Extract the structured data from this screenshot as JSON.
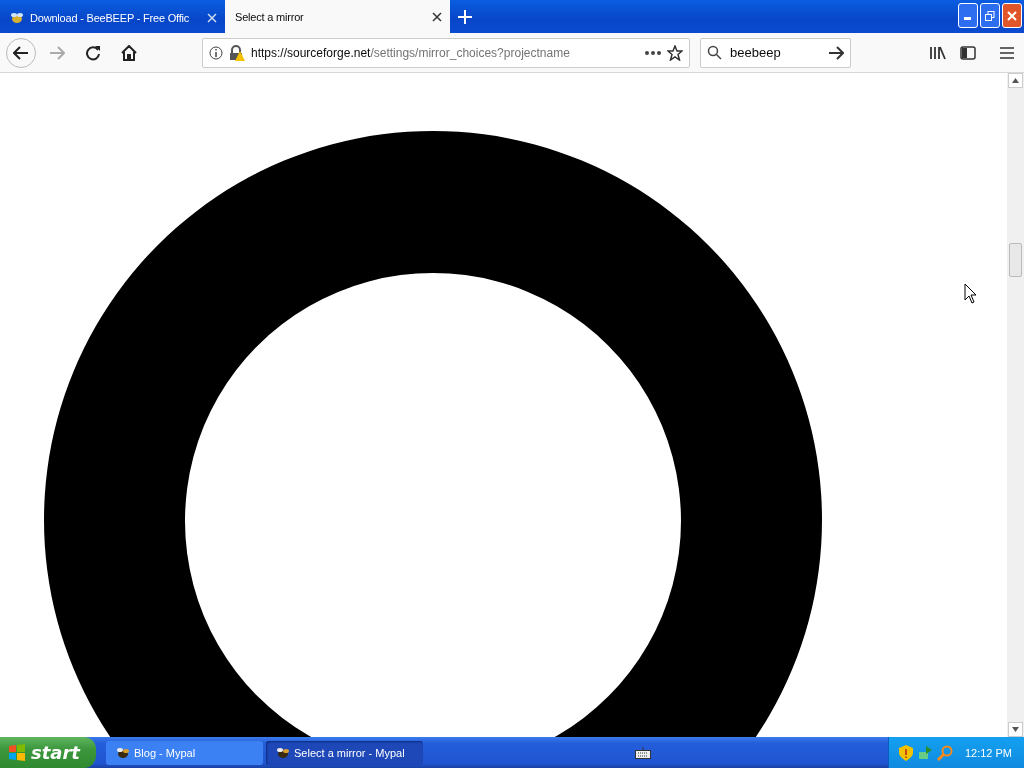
{
  "tabs": [
    {
      "label": "Download - BeeBEEP - Free Offic",
      "selected": false
    },
    {
      "label": "Select a mirror",
      "selected": true
    }
  ],
  "address_bar": {
    "host": "https://sourceforge.net",
    "path": "/settings/mirror_choices?projectname"
  },
  "search": {
    "value": "beebeep"
  },
  "taskbar": {
    "start_label": "start",
    "items": [
      {
        "label": "Blog - Mypal",
        "selected": false
      },
      {
        "label": "Select a mirror - Mypal",
        "selected": true
      }
    ],
    "clock": "12:12 PM"
  }
}
